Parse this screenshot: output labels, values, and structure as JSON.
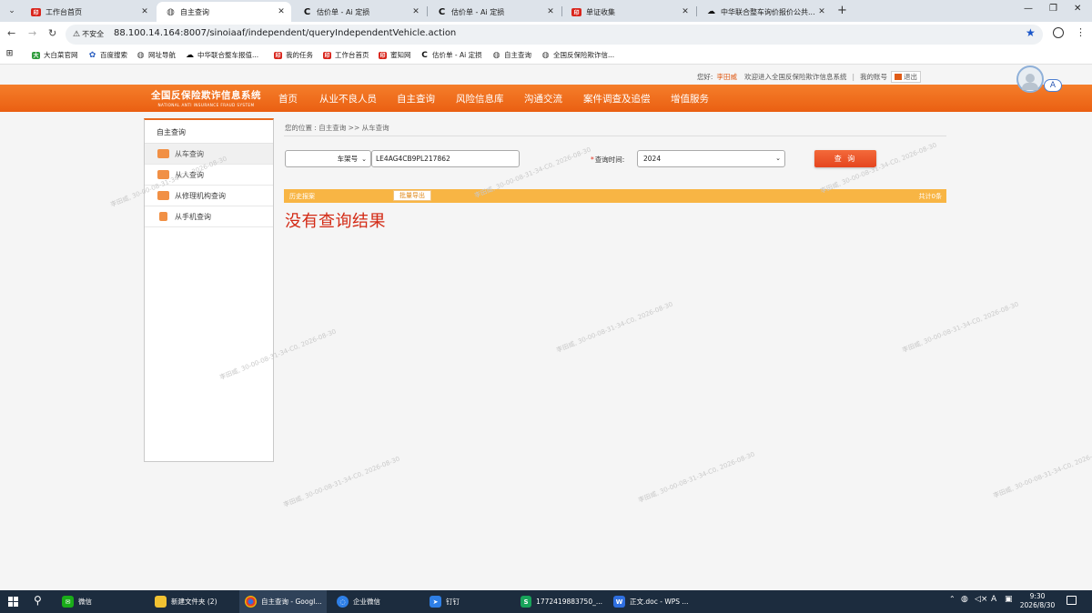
{
  "browser": {
    "tabs": [
      {
        "title": "工作台首页",
        "favicon": "red-logo-icon"
      },
      {
        "title": "自主查询",
        "favicon": "globe-icon"
      },
      {
        "title": "估价单 - Ai 定损",
        "favicon": "ai-logo-icon"
      },
      {
        "title": "估价单 - Ai 定损",
        "favicon": "ai-logo-icon"
      },
      {
        "title": "单证收集",
        "favicon": "red-logo-icon"
      },
      {
        "title": "中华联合整车询价报价公共...",
        "favicon": "car-logo-icon"
      }
    ],
    "insecure_label": "不安全",
    "url": "88.100.14.164:8007/sinoiaaf/independent/queryIndependentVehicle.action",
    "bookmarks": [
      "大白菜官网",
      "百度搜索",
      "网址导航",
      "中华联合整车报值...",
      "我的任务",
      "工作台首页",
      "蜜知网",
      "估价单 - Ai 定损",
      "自主查询",
      "全国反保险欺诈信..."
    ],
    "avatar_badge": "A"
  },
  "header": {
    "greeting": "您好:",
    "username": "李田威",
    "welcome": "欢迎进入全国反保险欺诈信息系统",
    "my_account": "我的账号",
    "logout": "退出"
  },
  "logo": {
    "cn": "全国反保险欺诈信息系统",
    "en": "NATIONAL ANTI INSURANCE FRAUD SYSTEM"
  },
  "nav": [
    "首页",
    "从业不良人员",
    "自主查询",
    "风险信息库",
    "沟通交流",
    "案件调查及追偿",
    "增值服务"
  ],
  "sidebar": {
    "title": "自主查询",
    "items": [
      "从车查询",
      "从人查询",
      "从修理机构查询",
      "从手机查询"
    ]
  },
  "main": {
    "breadcrumb": "您的位置 : 自主查询 >> 从车查询",
    "search_type": "车架号",
    "vin_value": "LE4AG4CB9PL217862",
    "time_label": "查询时间:",
    "year": "2024",
    "query_button": "查 询",
    "result_title": "历史报案",
    "export_button": "批量导出",
    "count_text": "共计0条",
    "no_result": "没有查询结果"
  },
  "watermark": "李田威, 30-00-08-31-34-C0, 2026-08-30",
  "taskbar": {
    "apps": [
      "微信",
      "新建文件夹 (2)",
      "自主查询 - Googl...",
      "企业微信",
      "钉钉",
      "1772419883750_...",
      "正文.doc - WPS ..."
    ],
    "time": "9:30",
    "date": "2026/8/30",
    "ime": "A"
  }
}
